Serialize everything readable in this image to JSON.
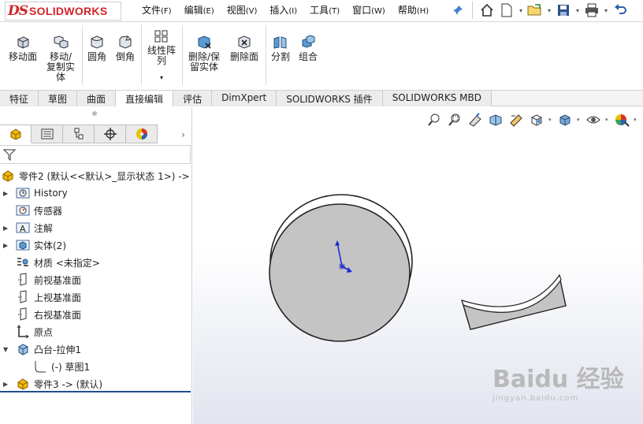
{
  "app": {
    "logo_ds": "DS",
    "logo_text": "SOLIDWORKS"
  },
  "menu": [
    {
      "label": "文件",
      "key": "(F)"
    },
    {
      "label": "编辑",
      "key": "(E)"
    },
    {
      "label": "视图",
      "key": "(V)"
    },
    {
      "label": "插入",
      "key": "(I)"
    },
    {
      "label": "工具",
      "key": "(T)"
    },
    {
      "label": "窗口",
      "key": "(W)"
    },
    {
      "label": "帮助",
      "key": "(H)"
    }
  ],
  "ribbon": {
    "move_face": "移动面",
    "move_copy_1": "移动/",
    "move_copy_2": "复制实",
    "move_copy_3": "体",
    "fillet": "圆角",
    "chamfer": "倒角",
    "linear_pattern_1": "线性阵",
    "linear_pattern_2": "列",
    "delete_keep_1": "删除/保",
    "delete_keep_2": "留实体",
    "delete_face": "删除面",
    "split": "分割",
    "combine": "组合"
  },
  "tabs": [
    "特征",
    "草图",
    "曲面",
    "直接编辑",
    "评估",
    "DimXpert",
    "SOLIDWORKS 插件",
    "SOLIDWORKS MBD"
  ],
  "active_tab": "直接编辑",
  "tree": {
    "root": "零件2  (默认<<默认>_显示状态 1>) ->",
    "items": [
      {
        "label": "History",
        "icon": "history-icon",
        "expandable": true
      },
      {
        "label": "传感器",
        "icon": "sensor-icon",
        "expandable": false
      },
      {
        "label": "注解",
        "icon": "annotation-icon",
        "expandable": true
      },
      {
        "label": "实体(2)",
        "icon": "solid-bodies-icon",
        "expandable": true
      },
      {
        "label": "材质 <未指定>",
        "icon": "material-icon",
        "expandable": false
      },
      {
        "label": "前视基准面",
        "icon": "plane-icon",
        "expandable": false
      },
      {
        "label": "上视基准面",
        "icon": "plane-icon",
        "expandable": false
      },
      {
        "label": "右视基准面",
        "icon": "plane-icon",
        "expandable": false
      },
      {
        "label": "原点",
        "icon": "origin-icon",
        "expandable": false
      },
      {
        "label": "凸台-拉伸1",
        "icon": "extrude-icon",
        "expandable": true
      },
      {
        "label": "(-) 草图1",
        "icon": "sketch-icon",
        "expandable": false
      },
      {
        "label": "零件3 -> (默认)",
        "icon": "part-icon",
        "expandable": true
      }
    ]
  },
  "watermark": {
    "main": "Baidu 经验",
    "sub": "jingyan.baidu.com"
  },
  "colors": {
    "brand": "#d2232a",
    "selection_line": "#1d4f91",
    "model_fill": "#c4c4c4"
  }
}
